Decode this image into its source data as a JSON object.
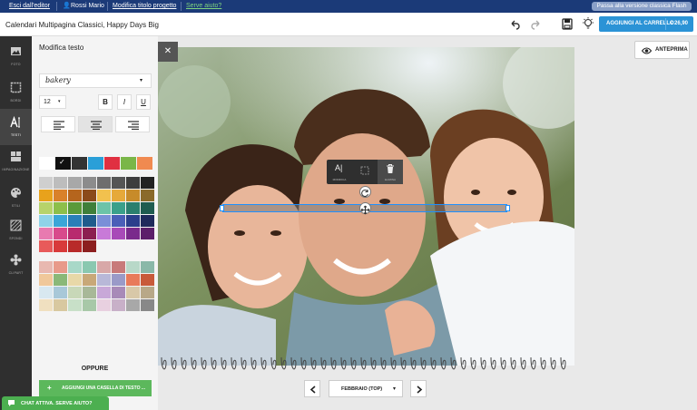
{
  "topbar": {
    "exit": "Esci dall'editor",
    "user": "Rossi Mario",
    "edit_title": "Modifica titolo progetto",
    "help": "Serve aiuto?",
    "flash": "Passa alla versione classica Flash"
  },
  "project": {
    "title": "Calendari Multipagina Classici, Happy Days Big"
  },
  "cart": {
    "label": "AGGIUNGI AL CARRELLO",
    "price": "€ 26,90"
  },
  "sidebar": {
    "items": [
      {
        "label": "FOTO",
        "icon": "photo-icon"
      },
      {
        "label": "BORDI",
        "icon": "borders-icon"
      },
      {
        "label": "TESTI",
        "icon": "text-icon"
      },
      {
        "label": "IMPAGINAZIONE",
        "icon": "layout-icon"
      },
      {
        "label": "STILI",
        "icon": "palette-icon"
      },
      {
        "label": "SFONDI",
        "icon": "background-icon"
      },
      {
        "label": "CLIPART",
        "icon": "clipart-icon"
      }
    ]
  },
  "panel": {
    "title": "Modifica testo",
    "font": "bakery",
    "size": "12",
    "bold": "B",
    "italic": "I",
    "underline": "U",
    "or": "OPPURE",
    "add_textbox": "AGGIUNGI UNA CASELLA DI TESTO ..."
  },
  "colors": {
    "row1": [
      "#ffffff",
      "#111111",
      "#333333",
      "#2a9fd8",
      "#e03041",
      "#7ab648",
      "#f08a50"
    ],
    "grid1": [
      "#cfcfcf",
      "#bdbdbd",
      "#a8a8a8",
      "#8c8c8c",
      "#6e6e6e",
      "#555555",
      "#3d3d3d",
      "#222222",
      "#e8a21c",
      "#d9812a",
      "#b5651d",
      "#8b4a1a",
      "#f2c14e",
      "#e6a93a",
      "#c78b2a",
      "#8a6a2a",
      "#b7d36b",
      "#8dbf4a",
      "#5a9a3a",
      "#3f7f3a",
      "#6cc3a8",
      "#3aa08a",
      "#2a7f6e",
      "#1f5c50",
      "#8fd3e8",
      "#3aa6d8",
      "#2a7fb8",
      "#1f5c8c",
      "#7a8fd8",
      "#4a5fb8",
      "#2a3f8c",
      "#1f2a5c",
      "#e87ab0",
      "#d84a8c",
      "#b82a6e",
      "#8c1f50",
      "#c87ad8",
      "#a84ab8",
      "#7a2a8c",
      "#5c1f6a",
      "#e85a5a",
      "#d83a3a",
      "#b82a2a",
      "#8c1f1f"
    ],
    "grid2": [
      "#e8b8b0",
      "#e89a8a",
      "#a8d8c8",
      "#8ac8b0",
      "#d8a8a8",
      "#c87a7a",
      "#b8d8c8",
      "#8ab8a8",
      "#f0c89a",
      "#8ab878",
      "#e8d8a8",
      "#c8a878",
      "#b8b8d8",
      "#9a9ac8",
      "#e87a5a",
      "#c85a3a",
      "#d8e8f0",
      "#a8c8d8",
      "#c8d8b8",
      "#a8b898",
      "#c8a8d8",
      "#a88ab8",
      "#d8c8a8",
      "#b8a888",
      "#f0e0c0",
      "#d8c8a0",
      "#c8e0c8",
      "#a8c8a8",
      "#e8d0e0",
      "#c8b0c8",
      "#a8a8a8",
      "#888888"
    ]
  },
  "canvas": {
    "textbox_tools": [
      {
        "label": "MODIFICA",
        "icon": "text-edit-icon"
      },
      {
        "label": "",
        "icon": "crop-icon"
      },
      {
        "label": "ELIMINA",
        "icon": "trash-icon"
      }
    ],
    "preview": "ANTEPRIMA",
    "month": "FEBBRAIO (TOP)"
  },
  "chat": {
    "label": "CHAT ATTIVA. SERVE AIUTO?"
  }
}
